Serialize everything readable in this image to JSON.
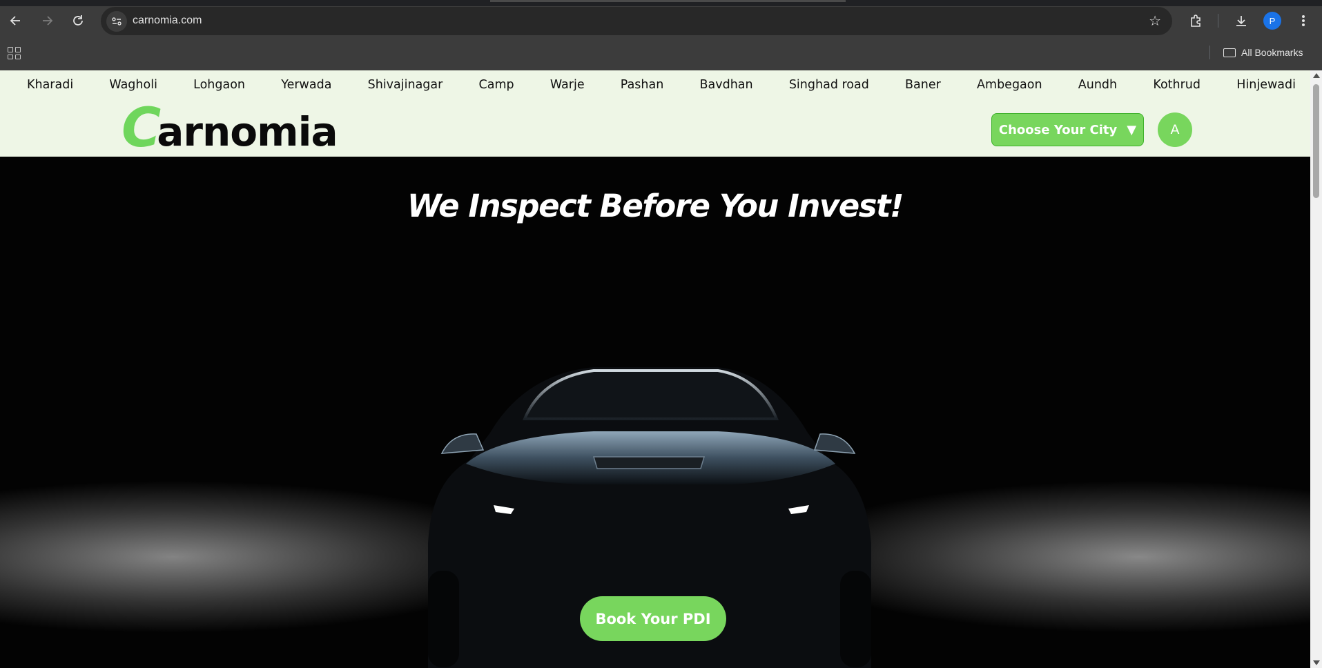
{
  "browser": {
    "url": "carnomia.com",
    "profile_initial": "P",
    "all_bookmarks_label": "All Bookmarks",
    "icons": [
      "back-arrow-icon",
      "forward-arrow-icon",
      "reload-icon",
      "site-info-icon",
      "star-icon",
      "extensions-icon",
      "download-icon",
      "menu-icon",
      "apps-grid-icon",
      "folder-icon"
    ]
  },
  "header": {
    "locations": [
      "Kharadi",
      "Wagholi",
      "Lohgaon",
      "Yerwada",
      "Shivajinagar",
      "Camp",
      "Warje",
      "Pashan",
      "Bavdhan",
      "Singhad road",
      "Baner",
      "Ambegaon",
      "Aundh",
      "Kothrud",
      "Hinjewadi"
    ],
    "logo_first_letter": "C",
    "logo_rest": "arnomia",
    "city_button_label": "Choose Your City",
    "city_button_arrow": "▼",
    "avatar_initial": "A"
  },
  "hero": {
    "title": "We Inspect Before You Invest!",
    "cta_label": "Book Your PDI"
  },
  "colors": {
    "brand_green": "#78d65d",
    "header_bg": "#eef6e6",
    "hero_bg": "#030303"
  }
}
